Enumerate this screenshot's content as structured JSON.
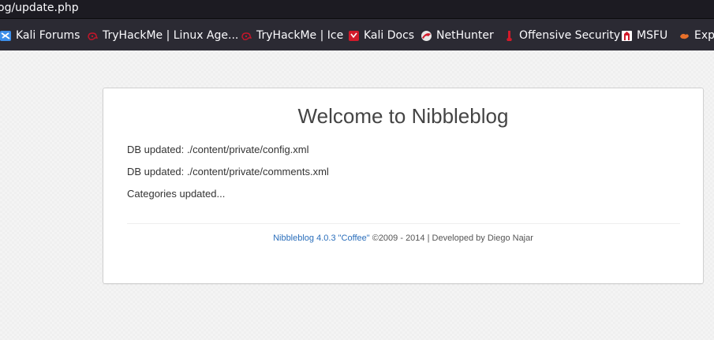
{
  "browser": {
    "url_fragment": "og/update.php",
    "bookmarks": [
      {
        "label": "Kali Forums",
        "icon": "kali-dragon-icon"
      },
      {
        "label": "TryHackMe | Linux Age...",
        "icon": "tryhackme-icon"
      },
      {
        "label": "TryHackMe | Ice",
        "icon": "tryhackme-icon"
      },
      {
        "label": "Kali Docs",
        "icon": "kali-docs-icon"
      },
      {
        "label": "NetHunter",
        "icon": "nethunter-icon"
      },
      {
        "label": "Offensive Security",
        "icon": "offsec-icon"
      },
      {
        "label": "MSFU",
        "icon": "msfu-icon"
      },
      {
        "label": "Expl",
        "icon": "exploit-db-icon"
      }
    ]
  },
  "page": {
    "title": "Welcome to Nibbleblog",
    "log": [
      "DB updated: ./content/private/config.xml",
      "DB updated: ./content/private/comments.xml",
      "Categories updated..."
    ],
    "footer": {
      "link_text": "Nibbleblog 4.0.3 \"Coffee\"",
      "text": " ©2009 - 2014 | Developed by Diego Najar"
    }
  },
  "colors": {
    "link": "#2a6ebb",
    "toolbar_bg": "#2b2a33",
    "urlbar_bg": "#1c1b22",
    "page_bg": "#f4f4f4"
  }
}
